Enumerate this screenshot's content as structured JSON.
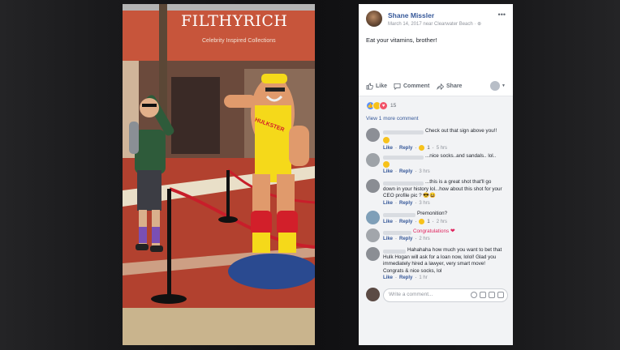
{
  "photo": {
    "store_sign": "FILTHYRICH",
    "store_tagline": "Celebrity Inspired Collections",
    "statue_shirt": "HULKSTER"
  },
  "post": {
    "author": "Shane Missler",
    "meta": "March 14, 2017 near Clearwater Beach · ",
    "text": "Eat your vitamins, brother!",
    "menu_icon": "more-horizontal-icon"
  },
  "actions": {
    "like": "Like",
    "comment": "Comment",
    "share": "Share"
  },
  "reactions": {
    "count": "15",
    "types": [
      "like",
      "haha",
      "love"
    ],
    "colors": {
      "like": "#5890ff",
      "haha": "#f7c21b",
      "love": "#f25268"
    }
  },
  "comments_section": {
    "view_more": "View 1 more comment",
    "write_placeholder": "Write a comment...",
    "items": [
      {
        "text": "Check out that sign above you!!",
        "sticker": "laughing-emoji",
        "like": "Like",
        "reply": "Reply",
        "reactions": "1",
        "time": "5 hrs"
      },
      {
        "text": "...nice socks..and sandals.. lol..",
        "sticker": "surprised-emoji",
        "like": "Like",
        "reply": "Reply",
        "time": "3 hrs"
      },
      {
        "text": "...this is a great shot that'll go down in your history lol...how about this shot for your CEO profile pic ? 😎😆",
        "like": "Like",
        "reply": "Reply",
        "time": "3 hrs"
      },
      {
        "text": "Premonition?",
        "like": "Like",
        "reply": "Reply",
        "reactions": "1",
        "time": "2 hrs"
      },
      {
        "text": "Congratulations",
        "like": "Like",
        "reply": "Reply",
        "time": "2 hrs"
      },
      {
        "text": "Hahahaha how much you want to bet that Hulk Hogan will ask for a loan now, lolol! Glad you immediately hired a lawyer, very smart move! Congrats & nice socks, lol",
        "like": "Like",
        "reply": "Reply",
        "time": "1 hr"
      }
    ]
  },
  "colors": {
    "link_blue": "#365899",
    "timestamp_gray": "#90949c",
    "comment_bg": "#f2f3f5",
    "congrats_red": "#e0245e"
  }
}
